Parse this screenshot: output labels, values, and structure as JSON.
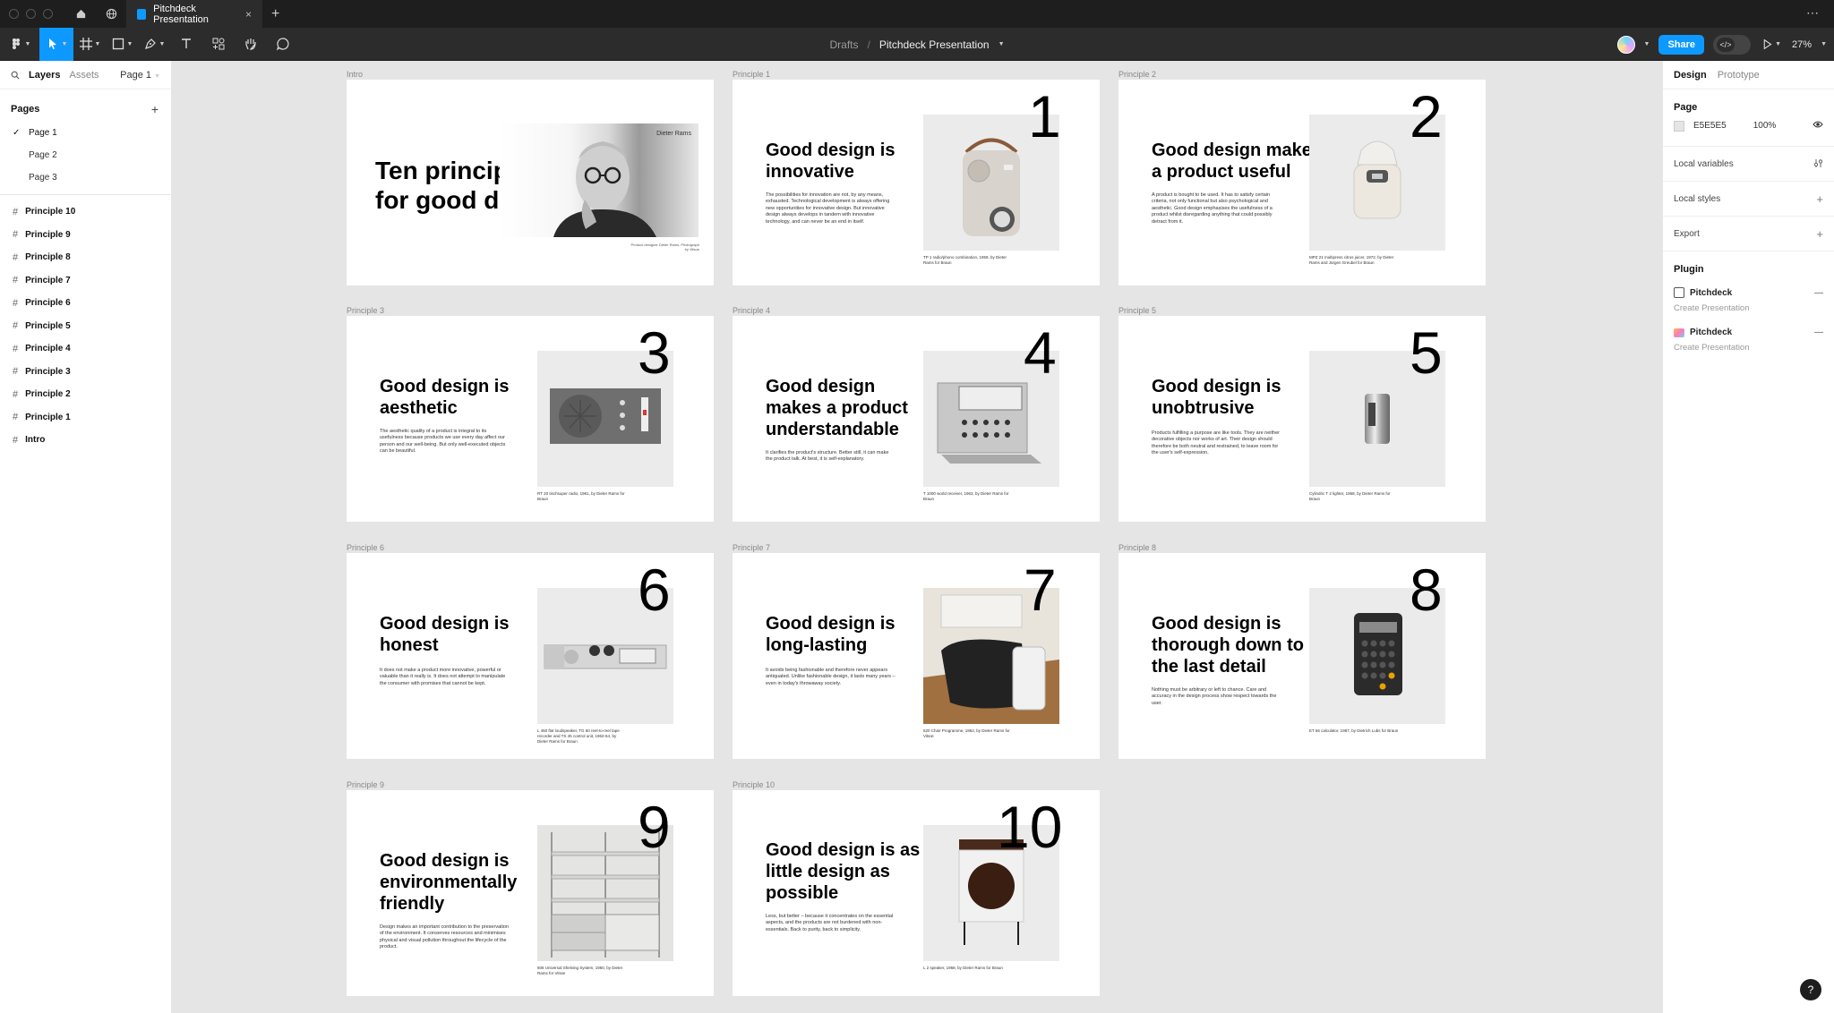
{
  "titlebar": {
    "tab_title": "Pitchdeck Presentation",
    "tab_close": "×",
    "new_tab": "+",
    "more": "⋯"
  },
  "toolbar": {
    "breadcrumb_project": "Drafts",
    "breadcrumb_sep": "/",
    "file_name": "Pitchdeck Presentation",
    "share_label": "Share",
    "zoom": "27%",
    "dev_mode": "</>"
  },
  "left_panel": {
    "tab_layers": "Layers",
    "tab_assets": "Assets",
    "current_page": "Page 1",
    "pages_heading": "Pages",
    "pages": [
      "Page 1",
      "Page 2",
      "Page 3"
    ],
    "layers": [
      "Principle 10",
      "Principle 9",
      "Principle 8",
      "Principle 7",
      "Principle 6",
      "Principle 5",
      "Principle 4",
      "Principle 3",
      "Principle 2",
      "Principle 1",
      "Intro"
    ]
  },
  "right_panel": {
    "tab_design": "Design",
    "tab_prototype": "Prototype",
    "page_heading": "Page",
    "page_color": "E5E5E5",
    "page_opacity": "100%",
    "local_variables": "Local variables",
    "local_styles": "Local styles",
    "export": "Export",
    "plugin_heading": "Plugin",
    "plugins": [
      {
        "name": "Pitchdeck",
        "action": "Create Presentation"
      },
      {
        "name": "Pitchdeck",
        "action": "Create Presentation"
      }
    ],
    "help": "?"
  },
  "intro": {
    "label": "Intro",
    "title": "Ten principles for good design",
    "photo_label": "Dieter Rams",
    "photo_caption": "Product designer Dieter Rams, Photograph by Vitsoe"
  },
  "principles": [
    {
      "label": "Principle 1",
      "number": "1",
      "title": "Good design is innovative",
      "body": "The possibilities for innovation are not, by any means, exhausted. Technological development is always offering new opportunities for innovative design. But innovative design always develops in tandem with innovative technology, and can never be an end in itself.",
      "caption": "TP 1 radio/phono combination, 1959, by Dieter Rams for Braun"
    },
    {
      "label": "Principle 2",
      "number": "2",
      "title": "Good design makes a product useful",
      "body": "A product is bought to be used. It has to satisfy certain criteria, not only functional but also psychological and aesthetic. Good design emphasises the usefulness of a product whilst disregarding anything that could possibly detract from it.",
      "caption": "MPZ 21 multipress citrus juicer, 1972, by Dieter Rams and Jürgen Greubel for Braun"
    },
    {
      "label": "Principle 3",
      "number": "3",
      "title": "Good design is aesthetic",
      "body": "The aesthetic quality of a product is integral to its usefulness because products we use every day affect our person and our well-being. But only well-executed objects can be beautiful.",
      "caption": "RT 20 tischsuper radio, 1961, by Dieter Rams for Braun"
    },
    {
      "label": "Principle 4",
      "number": "4",
      "title": "Good design makes a product understandable",
      "body": "It clarifies the product's structure. Better still, it can make the product talk. At best, it is self-explanatory.",
      "caption": "T 1000 world receiver, 1963, by Dieter Rams for Braun"
    },
    {
      "label": "Principle 5",
      "number": "5",
      "title": "Good design is unobtrusive",
      "body": "Products fulfilling a purpose are like tools. They are neither decorative objects nor works of art. Their design should therefore be both neutral and restrained, to leave room for the user's self-expression.",
      "caption": "Cylindric T 2 lighter, 1968, by Dieter Rams for Braun"
    },
    {
      "label": "Principle 6",
      "number": "6",
      "title": "Good design is honest",
      "body": "It does not make a product more innovative, powerful or valuable than it really is. It does not attempt to manipulate the consumer with promises that cannot be kept.",
      "caption": "L 450 flat loudspeaker, TG 60 reel-to-reel tape recorder and TS 45 control unit, 1962-64, by Dieter Rams for Braun"
    },
    {
      "label": "Principle 7",
      "number": "7",
      "title": "Good design is long-lasting",
      "body": "It avoids being fashionable and therefore never appears antiquated. Unlike fashionable design, it lasts many years – even in today's throwaway society.",
      "caption": "620 Chair Programme, 1962, by Dieter Rams for Vitsœ"
    },
    {
      "label": "Principle 8",
      "number": "8",
      "title": "Good design is thorough down to the last detail",
      "body": "Nothing must be arbitrary or left to chance. Care and accuracy in the design process show respect towards the user.",
      "caption": "ET 66 calculator, 1987, by Dietrich Lubs for Braun"
    },
    {
      "label": "Principle 9",
      "number": "9",
      "title": "Good design is environmentally friendly",
      "body": "Design makes an important contribution to the preservation of the environment. It conserves resources and minimises physical and visual pollution throughout the lifecycle of the product.",
      "caption": "606 Universal Shelving System, 1960, by Dieter Rams for Vitsœ"
    },
    {
      "label": "Principle 10",
      "number": "10",
      "title": "Good design is as little design as possible",
      "body": "Less, but better – because it concentrates on the essential aspects, and the products are not burdened with non-essentials. Back to purity, back to simplicity.",
      "caption": "L 2 speaker, 1958, by Dieter Rams for Braun"
    }
  ]
}
